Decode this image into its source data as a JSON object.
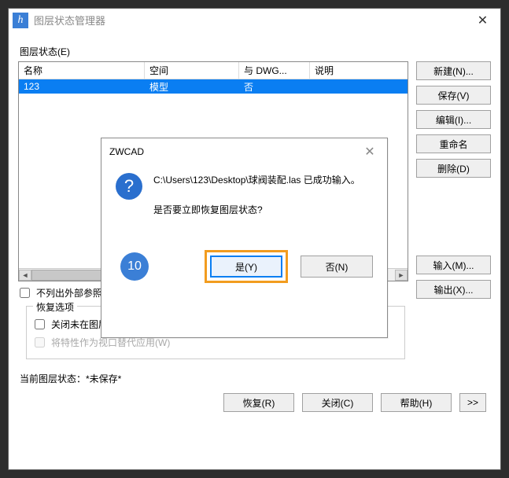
{
  "window": {
    "icon_text": "h",
    "title": "图层状态管理器"
  },
  "section_label": "图层状态(E)",
  "columns": {
    "name": "名称",
    "space": "空间",
    "dwg": "与 DWG...",
    "desc": "说明"
  },
  "row": {
    "name": "123",
    "space": "模型",
    "dwg": "否",
    "desc": ""
  },
  "buttons": {
    "new": "新建(N)...",
    "save": "保存(V)",
    "edit": "编辑(I)...",
    "rename": "重命名",
    "delete": "删除(D)",
    "input": "输入(M)...",
    "output": "输出(X)..."
  },
  "checkbox_external": "不列出外部参照",
  "restore_group": {
    "legend": "恢复选项",
    "close_not_found": "关闭未在图层状态中找到的图层(T)",
    "viewport_override": "将特性作为视口替代应用(W)"
  },
  "status_label": "当前图层状态：",
  "status_value": "*未保存*",
  "bottom": {
    "restore": "恢复(R)",
    "close": "关闭(C)",
    "help": "帮助(H)",
    "expand": ">>"
  },
  "modal": {
    "title": "ZWCAD",
    "line1": "C:\\Users\\123\\Desktop\\球阀装配.las 已成功输入。",
    "line2": "是否要立即恢复图层状态?",
    "yes": "是(Y)",
    "no": "否(N)",
    "step": "10"
  }
}
